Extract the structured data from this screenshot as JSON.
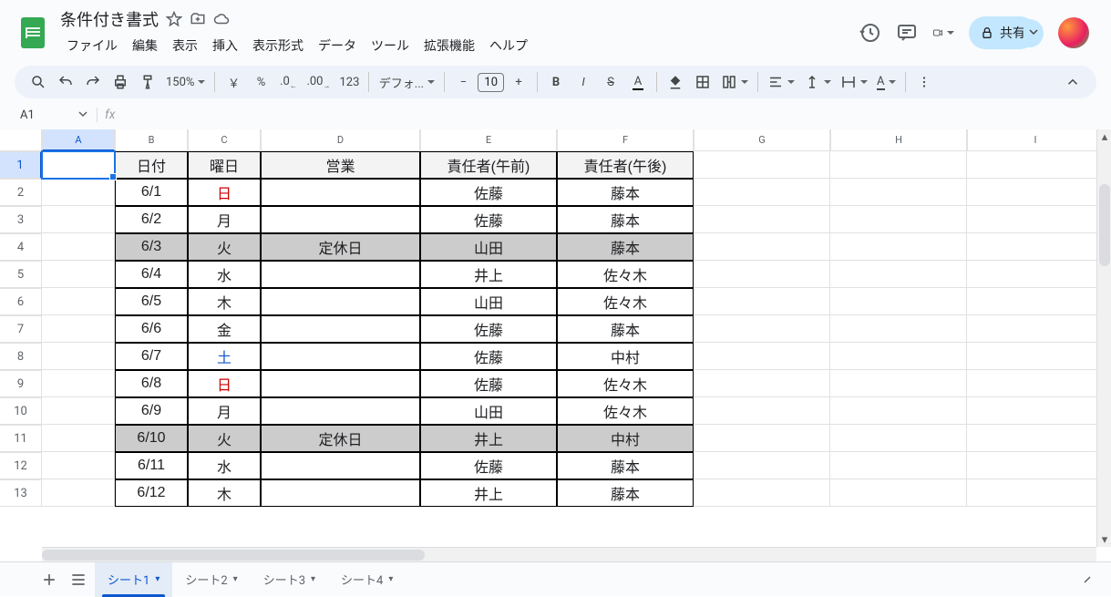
{
  "header": {
    "title": "条件付き書式",
    "menus": [
      "ファイル",
      "編集",
      "表示",
      "挿入",
      "表示形式",
      "データ",
      "ツール",
      "拡張機能",
      "ヘルプ"
    ],
    "share_label": "共有"
  },
  "toolbar": {
    "zoom": "150%",
    "currency": "￥",
    "percent": "%",
    "dec_minus": ".0",
    "dec_plus": ".00",
    "num123": "123",
    "font": "デフォ...",
    "font_size": "10",
    "minus": "−",
    "plus": "+"
  },
  "namebox": {
    "value": "A1",
    "fx": "fx"
  },
  "columns": [
    "A",
    "B",
    "C",
    "D",
    "E",
    "F",
    "G",
    "H",
    "I"
  ],
  "row_count": 13,
  "table": {
    "headers": [
      "日付",
      "曜日",
      "営業",
      "責任者(午前)",
      "責任者(午後)"
    ],
    "rows": [
      {
        "date": "6/1",
        "day": "日",
        "biz": "",
        "am": "佐藤",
        "pm": "藤本",
        "day_color": "red",
        "shade": false
      },
      {
        "date": "6/2",
        "day": "月",
        "biz": "",
        "am": "佐藤",
        "pm": "藤本",
        "day_color": "",
        "shade": false
      },
      {
        "date": "6/3",
        "day": "火",
        "biz": "定休日",
        "am": "山田",
        "pm": "藤本",
        "day_color": "",
        "shade": true
      },
      {
        "date": "6/4",
        "day": "水",
        "biz": "",
        "am": "井上",
        "pm": "佐々木",
        "day_color": "",
        "shade": false
      },
      {
        "date": "6/5",
        "day": "木",
        "biz": "",
        "am": "山田",
        "pm": "佐々木",
        "day_color": "",
        "shade": false
      },
      {
        "date": "6/6",
        "day": "金",
        "biz": "",
        "am": "佐藤",
        "pm": "藤本",
        "day_color": "",
        "shade": false
      },
      {
        "date": "6/7",
        "day": "土",
        "biz": "",
        "am": "佐藤",
        "pm": "中村",
        "day_color": "blue",
        "shade": false
      },
      {
        "date": "6/8",
        "day": "日",
        "biz": "",
        "am": "佐藤",
        "pm": "佐々木",
        "day_color": "red",
        "shade": false
      },
      {
        "date": "6/9",
        "day": "月",
        "biz": "",
        "am": "山田",
        "pm": "佐々木",
        "day_color": "",
        "shade": false
      },
      {
        "date": "6/10",
        "day": "火",
        "biz": "定休日",
        "am": "井上",
        "pm": "中村",
        "day_color": "",
        "shade": true
      },
      {
        "date": "6/11",
        "day": "水",
        "biz": "",
        "am": "佐藤",
        "pm": "藤本",
        "day_color": "",
        "shade": false
      },
      {
        "date": "6/12",
        "day": "木",
        "biz": "",
        "am": "井上",
        "pm": "藤本",
        "day_color": "",
        "shade": false
      }
    ]
  },
  "sheets": {
    "items": [
      "シート1",
      "シート2",
      "シート3",
      "シート4"
    ],
    "active_index": 0
  }
}
